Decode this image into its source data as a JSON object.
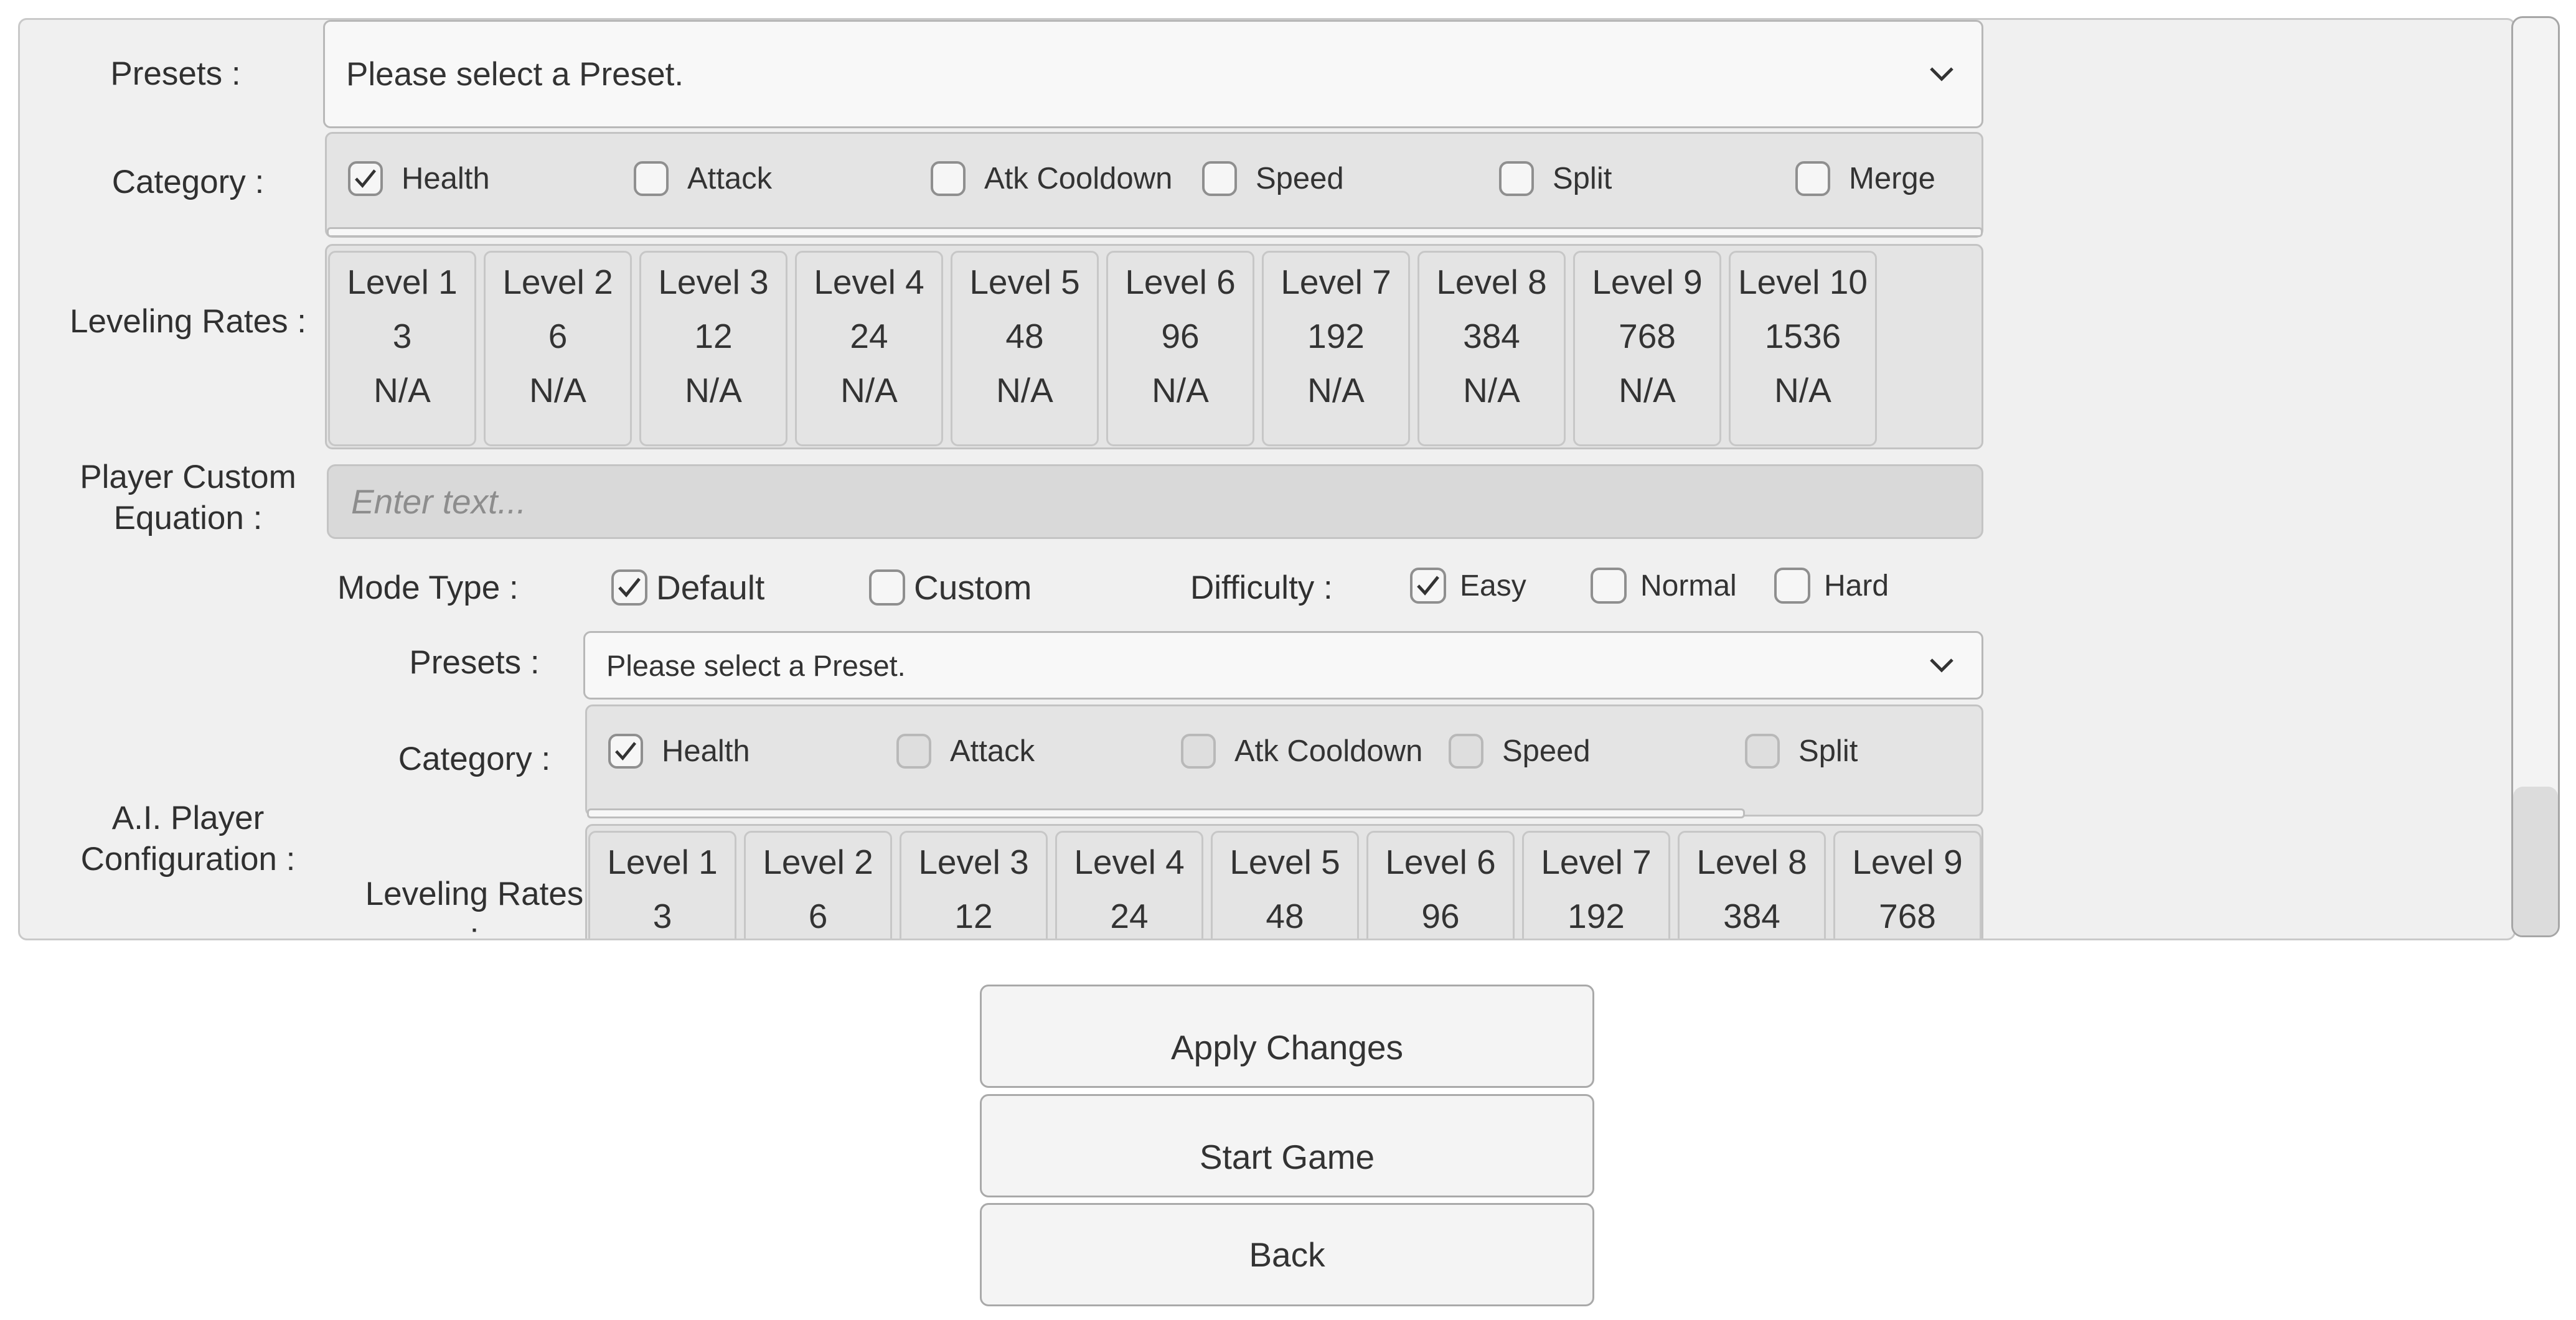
{
  "player": {
    "presets_label": "Presets :",
    "presets_value": "Please select a Preset.",
    "category_label": "Category :",
    "categories": [
      {
        "label": "Health",
        "checked": true
      },
      {
        "label": "Attack",
        "checked": false
      },
      {
        "label": "Atk Cooldown",
        "checked": false
      },
      {
        "label": "Speed",
        "checked": false
      },
      {
        "label": "Split",
        "checked": false
      },
      {
        "label": "Merge",
        "checked": false
      }
    ],
    "leveling_label": "Leveling Rates :",
    "levels": [
      {
        "name": "Level 1",
        "value": "3",
        "extra": "N/A"
      },
      {
        "name": "Level 2",
        "value": "6",
        "extra": "N/A"
      },
      {
        "name": "Level 3",
        "value": "12",
        "extra": "N/A"
      },
      {
        "name": "Level 4",
        "value": "24",
        "extra": "N/A"
      },
      {
        "name": "Level 5",
        "value": "48",
        "extra": "N/A"
      },
      {
        "name": "Level 6",
        "value": "96",
        "extra": "N/A"
      },
      {
        "name": "Level 7",
        "value": "192",
        "extra": "N/A"
      },
      {
        "name": "Level 8",
        "value": "384",
        "extra": "N/A"
      },
      {
        "name": "Level 9",
        "value": "768",
        "extra": "N/A"
      },
      {
        "name": "Level 10",
        "value": "1536",
        "extra": "N/A"
      }
    ],
    "custom_equation_label": "Player Custom Equation :",
    "custom_equation_placeholder": "Enter text..."
  },
  "ai": {
    "config_label": "A.I. Player Configuration :",
    "mode_type_label": "Mode Type :",
    "mode_types": [
      {
        "label": "Default",
        "checked": true
      },
      {
        "label": "Custom",
        "checked": false
      }
    ],
    "difficulty_label": "Difficulty :",
    "difficulties": [
      {
        "label": "Easy",
        "checked": true
      },
      {
        "label": "Normal",
        "checked": false
      },
      {
        "label": "Hard",
        "checked": false
      }
    ],
    "presets_label": "Presets :",
    "presets_value": "Please select a Preset.",
    "category_label": "Category :",
    "categories": [
      {
        "label": "Health",
        "checked": true
      },
      {
        "label": "Attack",
        "checked": false
      },
      {
        "label": "Atk Cooldown",
        "checked": false
      },
      {
        "label": "Speed",
        "checked": false
      },
      {
        "label": "Split",
        "checked": false
      }
    ],
    "leveling_label": "Leveling Rates :",
    "levels": [
      {
        "name": "Level 1",
        "value": "3"
      },
      {
        "name": "Level 2",
        "value": "6"
      },
      {
        "name": "Level 3",
        "value": "12"
      },
      {
        "name": "Level 4",
        "value": "24"
      },
      {
        "name": "Level 5",
        "value": "48"
      },
      {
        "name": "Level 6",
        "value": "96"
      },
      {
        "name": "Level 7",
        "value": "192"
      },
      {
        "name": "Level 8",
        "value": "384"
      },
      {
        "name": "Level 9",
        "value": "768"
      }
    ]
  },
  "buttons": {
    "apply": "Apply Changes",
    "start": "Start Game",
    "back": "Back"
  },
  "icons": {
    "chevron": "chevron-down-icon",
    "check": "checkmark-icon"
  }
}
